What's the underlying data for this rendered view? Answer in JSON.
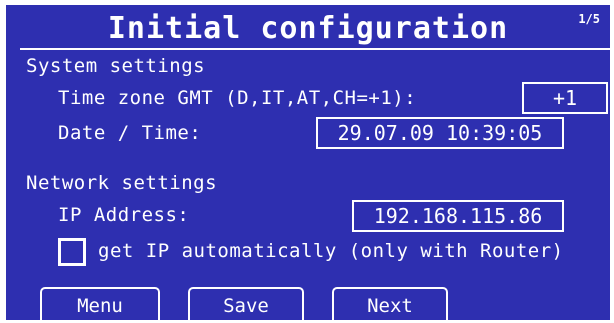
{
  "header": {
    "title": "Initial configuration",
    "page_indicator": "1/5"
  },
  "system": {
    "section_label": "System settings",
    "timezone_label": "Time zone GMT (D,IT,AT,CH=+1):",
    "timezone_value": "+1",
    "datetime_label": "Date / Time:",
    "datetime_value": "29.07.09 10:39:05"
  },
  "network": {
    "section_label": "Network settings",
    "ip_label": "IP Address:",
    "ip_value": "192.168.115.86",
    "auto_ip_label": "get IP automatically (only with Router)",
    "auto_ip_checked": false
  },
  "buttons": {
    "menu": "Menu",
    "save": "Save",
    "next": "Next"
  },
  "colors": {
    "background": "#2e2fb0",
    "foreground": "#ffffff"
  }
}
